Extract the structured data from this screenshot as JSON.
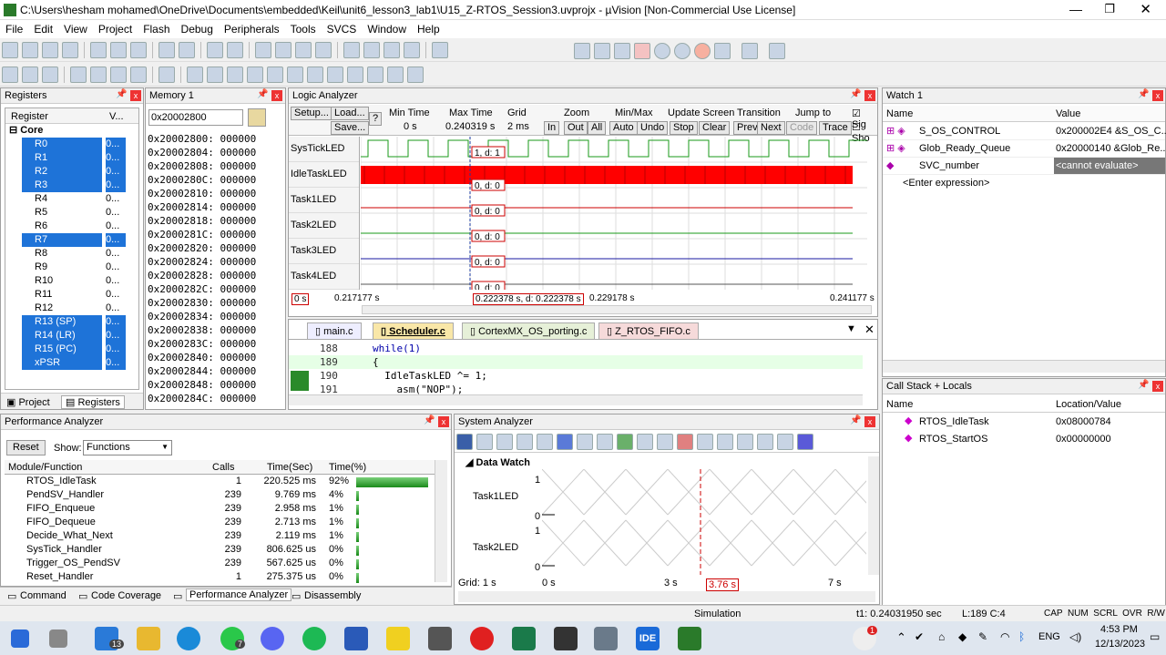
{
  "title": "C:\\Users\\hesham mohamed\\OneDrive\\Documents\\embedded\\Keil\\unit6_lesson3_lab1\\U15_Z-RTOS_Session3.uvprojx - µVision  [Non-Commercial Use License]",
  "menu": [
    "File",
    "Edit",
    "View",
    "Project",
    "Flash",
    "Debug",
    "Peripherals",
    "Tools",
    "SVCS",
    "Window",
    "Help"
  ],
  "registers": {
    "header": "Registers",
    "col1": "Register",
    "col2": "V...",
    "group": "Core",
    "rows": [
      "R0",
      "R1",
      "R2",
      "R3",
      "R4",
      "R5",
      "R6",
      "R7",
      "R8",
      "R9",
      "R10",
      "R11",
      "R12",
      "R13 (SP)",
      "R14 (LR)",
      "R15 (PC)",
      "xPSR"
    ],
    "val": "0...",
    "tabs": [
      "Project",
      "Registers"
    ]
  },
  "memory": {
    "header": "Memory 1",
    "address": "0x20002800",
    "rows": [
      "0x20002800: 000000",
      "0x20002804: 000000",
      "0x20002808: 000000",
      "0x2000280C: 000000",
      "0x20002810: 000000",
      "0x20002814: 000000",
      "0x20002818: 000000",
      "0x2000281C: 000000",
      "0x20002820: 000000",
      "0x20002824: 000000",
      "0x20002828: 000000",
      "0x2000282C: 000000",
      "0x20002830: 000000",
      "0x20002834: 000000",
      "0x20002838: 000000",
      "0x2000283C: 000000",
      "0x20002840: 000000",
      "0x20002844: 000000",
      "0x20002848: 000000",
      "0x2000284C: 000000"
    ]
  },
  "logic": {
    "header": "Logic Analyzer",
    "setup": "Setup...",
    "load": "Load...",
    "save": "Save...",
    "q": "?",
    "min_time_lbl": "Min Time",
    "min_time": "0 s",
    "max_time_lbl": "Max Time",
    "max_time": "0.240319 s",
    "grid_lbl": "Grid",
    "grid": "2 ms",
    "zoom_lbl": "Zoom",
    "zoom_btns": [
      "In",
      "Out",
      "All"
    ],
    "minmax_lbl": "Min/Max",
    "minmax_btns": [
      "Auto",
      "Undo"
    ],
    "upd_lbl": "Update Screen",
    "upd_btns": [
      "Stop",
      "Clear"
    ],
    "trans_lbl": "Transition",
    "trans_btns": [
      "Prev",
      "Next"
    ],
    "jump_lbl": "Jump to",
    "jump_btns": [
      "Code",
      "Trace"
    ],
    "sig": "Sig",
    "sho": "Sho",
    "signals": [
      "SysTickLED",
      "IdleTaskLED",
      "Task1LED",
      "Task2LED",
      "Task3LED",
      "Task4LED"
    ],
    "markers": [
      "1, d: 1",
      "0, d: 0",
      "0, d: 0",
      "0, d: 0",
      "0, d: 0",
      "0, d: 0"
    ],
    "t0": "0 s",
    "t1": "0.217177 s",
    "t2": "0.222378 s,  d: 0.222378 s",
    "t3": "0.229178 s",
    "t4": "0.241177 s"
  },
  "editor": {
    "tabs": [
      "main.c",
      "Scheduler.c",
      "CortexMX_OS_porting.c",
      "Z_RTOS_FIFO.c"
    ],
    "lines": [
      {
        "n": "188",
        "code": "while(1)"
      },
      {
        "n": "189",
        "code": "{"
      },
      {
        "n": "190",
        "code": "  IdleTaskLED ^= 1;"
      },
      {
        "n": "191",
        "code": "    asm(\"NOP\");"
      }
    ]
  },
  "watch": {
    "header": "Watch 1",
    "col_name": "Name",
    "col_value": "Value",
    "rows": [
      {
        "name": "S_OS_CONTROL",
        "value": "0x200002E4 &S_OS_C..."
      },
      {
        "name": "Glob_Ready_Queue",
        "value": "0x20000140 &Glob_Re..."
      },
      {
        "name": "SVC_number",
        "value": "<cannot evaluate>"
      }
    ],
    "enter": "<Enter expression>"
  },
  "callstack": {
    "header": "Call Stack + Locals",
    "col_name": "Name",
    "col_loc": "Location/Value",
    "rows": [
      {
        "name": "RTOS_IdleTask",
        "value": "0x08000784"
      },
      {
        "name": "RTOS_StartOS",
        "value": "0x00000000"
      }
    ]
  },
  "perf": {
    "header": "Performance Analyzer",
    "reset": "Reset",
    "show": "Show:",
    "show_val": "Functions",
    "cols": [
      "Module/Function",
      "Calls",
      "Time(Sec)",
      "Time(%)"
    ],
    "rows": [
      {
        "f": "RTOS_IdleTask",
        "c": "1",
        "t": "220.525 ms",
        "p": "92%",
        "pct": 0.92
      },
      {
        "f": "PendSV_Handler",
        "c": "239",
        "t": "9.769 ms",
        "p": "4%",
        "pct": 0.04
      },
      {
        "f": "FIFO_Enqueue",
        "c": "239",
        "t": "2.958 ms",
        "p": "1%",
        "pct": 0.01
      },
      {
        "f": "FIFO_Dequeue",
        "c": "239",
        "t": "2.713 ms",
        "p": "1%",
        "pct": 0.01
      },
      {
        "f": "Decide_What_Next",
        "c": "239",
        "t": "2.119 ms",
        "p": "1%",
        "pct": 0.01
      },
      {
        "f": "SysTick_Handler",
        "c": "239",
        "t": "806.625 us",
        "p": "0%",
        "pct": 0.003
      },
      {
        "f": "Trigger_OS_PendSV",
        "c": "239",
        "t": "567.625 us",
        "p": "0%",
        "pct": 0.002
      },
      {
        "f": "Reset_Handler",
        "c": "1",
        "t": "275.375 us",
        "p": "0%",
        "pct": 0.001
      }
    ],
    "tabs": [
      "Command",
      "Code Coverage",
      "Performance Analyzer",
      "Disassembly"
    ]
  },
  "sysan": {
    "header": "System Analyzer",
    "data_watch": "Data Watch",
    "signals": [
      "Task1LED",
      "Task2LED"
    ],
    "one": "1",
    "zero": "0",
    "grid": "Grid: 1 s",
    "ticks": [
      "0 s",
      "3 s",
      "3.76 s",
      "7 s"
    ]
  },
  "status": {
    "sim": "Simulation",
    "t1": "t1: 0.24031950 sec",
    "pos": "L:189 C:4",
    "caps": "CAP  NUM  SCRL  OVR  R/W"
  },
  "taskbar": {
    "time": "4:53 PM",
    "date": "12/13/2023",
    "lang": "ENG",
    "badge_mail": "13",
    "badge_wa": "7",
    "badge_weather": "1"
  }
}
